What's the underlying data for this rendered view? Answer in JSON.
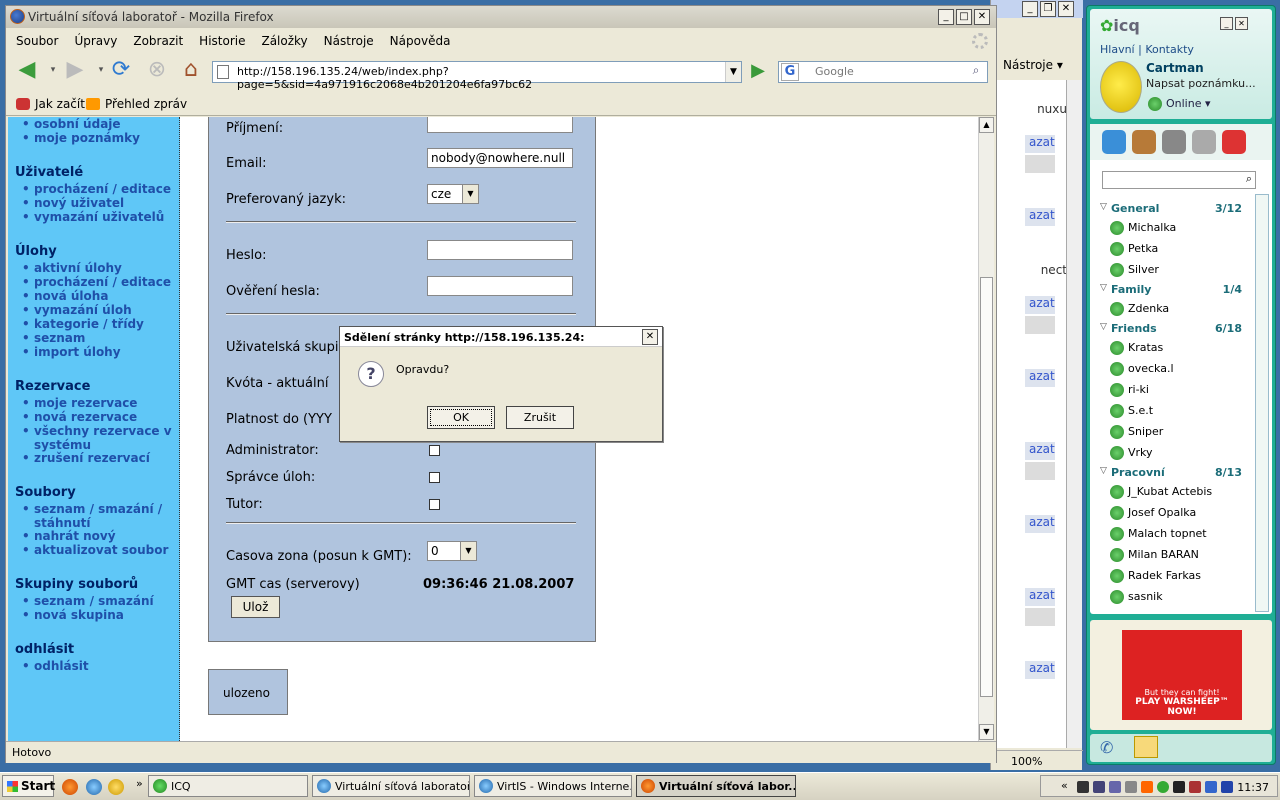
{
  "firefox": {
    "title": "Virtuální síťová laboratoř - Mozilla Firefox",
    "menu": [
      "Soubor",
      "Úpravy",
      "Zobrazit",
      "Historie",
      "Záložky",
      "Nástroje",
      "Nápověda"
    ],
    "url": "http://158.196.135.24/web/index.php?page=5&sid=4a971916c2068e4b201204e6fa97bc62",
    "search_placeholder": "Google",
    "bookmarks": [
      "Jak začít",
      "Přehled zpráv"
    ],
    "status": "Hotovo"
  },
  "sidebar": {
    "top_links": [
      "osobní údaje",
      "moje poznámky"
    ],
    "sections": [
      {
        "heading": "Uživatelé",
        "links": [
          "procházení / editace",
          "nový uživatel",
          "vymazání uživatelů"
        ]
      },
      {
        "heading": "Úlohy",
        "links": [
          "aktivní úlohy",
          "procházení / editace",
          "nová úloha",
          "vymazání úloh",
          "kategorie / třídy",
          "seznam",
          "import úlohy"
        ]
      },
      {
        "heading": "Rezervace",
        "links": [
          "moje rezervace",
          "nová rezervace",
          "všechny rezervace v systému",
          "zrušení rezervací"
        ]
      },
      {
        "heading": "Soubory",
        "links": [
          "seznam / smazání / stáhnutí",
          "nahrát nový",
          "aktualizovat soubor"
        ]
      },
      {
        "heading": "Skupiny souborů",
        "links": [
          "seznam / smazání",
          "nová skupina"
        ]
      },
      {
        "heading": "odhlásit",
        "links": [
          "odhlásit"
        ]
      }
    ]
  },
  "form": {
    "surname_label": "Příjmení:",
    "surname_value": "",
    "email_label": "Email:",
    "email_value": "nobody@nowhere.null",
    "lang_label": "Preferovaný jazyk:",
    "lang_value": "cze",
    "password_label": "Heslo:",
    "password_confirm_label": "Ověření hesla:",
    "group_label": "Uživatelská skupi",
    "quota_label": "Kvóta - aktuální",
    "valid_label": "Platnost do (YYY",
    "admin_label": "Administrator:",
    "task_admin_label": "Správce úloh:",
    "tutor_label": "Tutor:",
    "tz_label": "Casova zona (posun k GMT):",
    "tz_value": "0",
    "gmt_label": "GMT cas (serverovy)",
    "gmt_value": "09:36:46 21.08.2007",
    "save_button": "Ulož",
    "saved_message": "ulozeno"
  },
  "dialog": {
    "title": "Sdělení stránky http://158.196.135.24:",
    "message": "Opravdu?",
    "ok": "OK",
    "cancel": "Zrušit"
  },
  "bg_window": {
    "tools": "Nástroje",
    "snippets": [
      "nuxu",
      "nect"
    ],
    "link_text": "azat",
    "zoom": "100%"
  },
  "icq": {
    "logo": "icq",
    "tab_main": "Hlavní",
    "tab_contacts": "Kontakty",
    "user": "Cartman",
    "note": "Napsat poznámku...",
    "status": "Online",
    "groups": [
      {
        "name": "General",
        "count": "3/12",
        "contacts": [
          "Michalka",
          "Petka",
          "Silver"
        ]
      },
      {
        "name": "Family",
        "count": "1/4",
        "contacts": [
          "Zdenka"
        ]
      },
      {
        "name": "Friends",
        "count": "6/18",
        "contacts": [
          "Kratas",
          "ovecka.l",
          "ri-ki",
          "S.e.t",
          "Sniper",
          "Vrky"
        ]
      },
      {
        "name": "Pracovní",
        "count": "8/13",
        "contacts": [
          "J_Kubat Actebis",
          "Josef Opalka",
          "Malach topnet",
          "Milan BARAN",
          "Radek Farkas",
          "sasnik"
        ]
      }
    ],
    "ad_line1": "But they can fight!",
    "ad_line2": "PLAY WARSHEEP™ NOW!"
  },
  "taskbar": {
    "start": "Start",
    "buttons": [
      "ICQ",
      "Virtuální síťová laboratoř...",
      "VirtIS - Windows Interne...",
      "Virtuální síťová labor..."
    ],
    "clock": "11:37"
  }
}
